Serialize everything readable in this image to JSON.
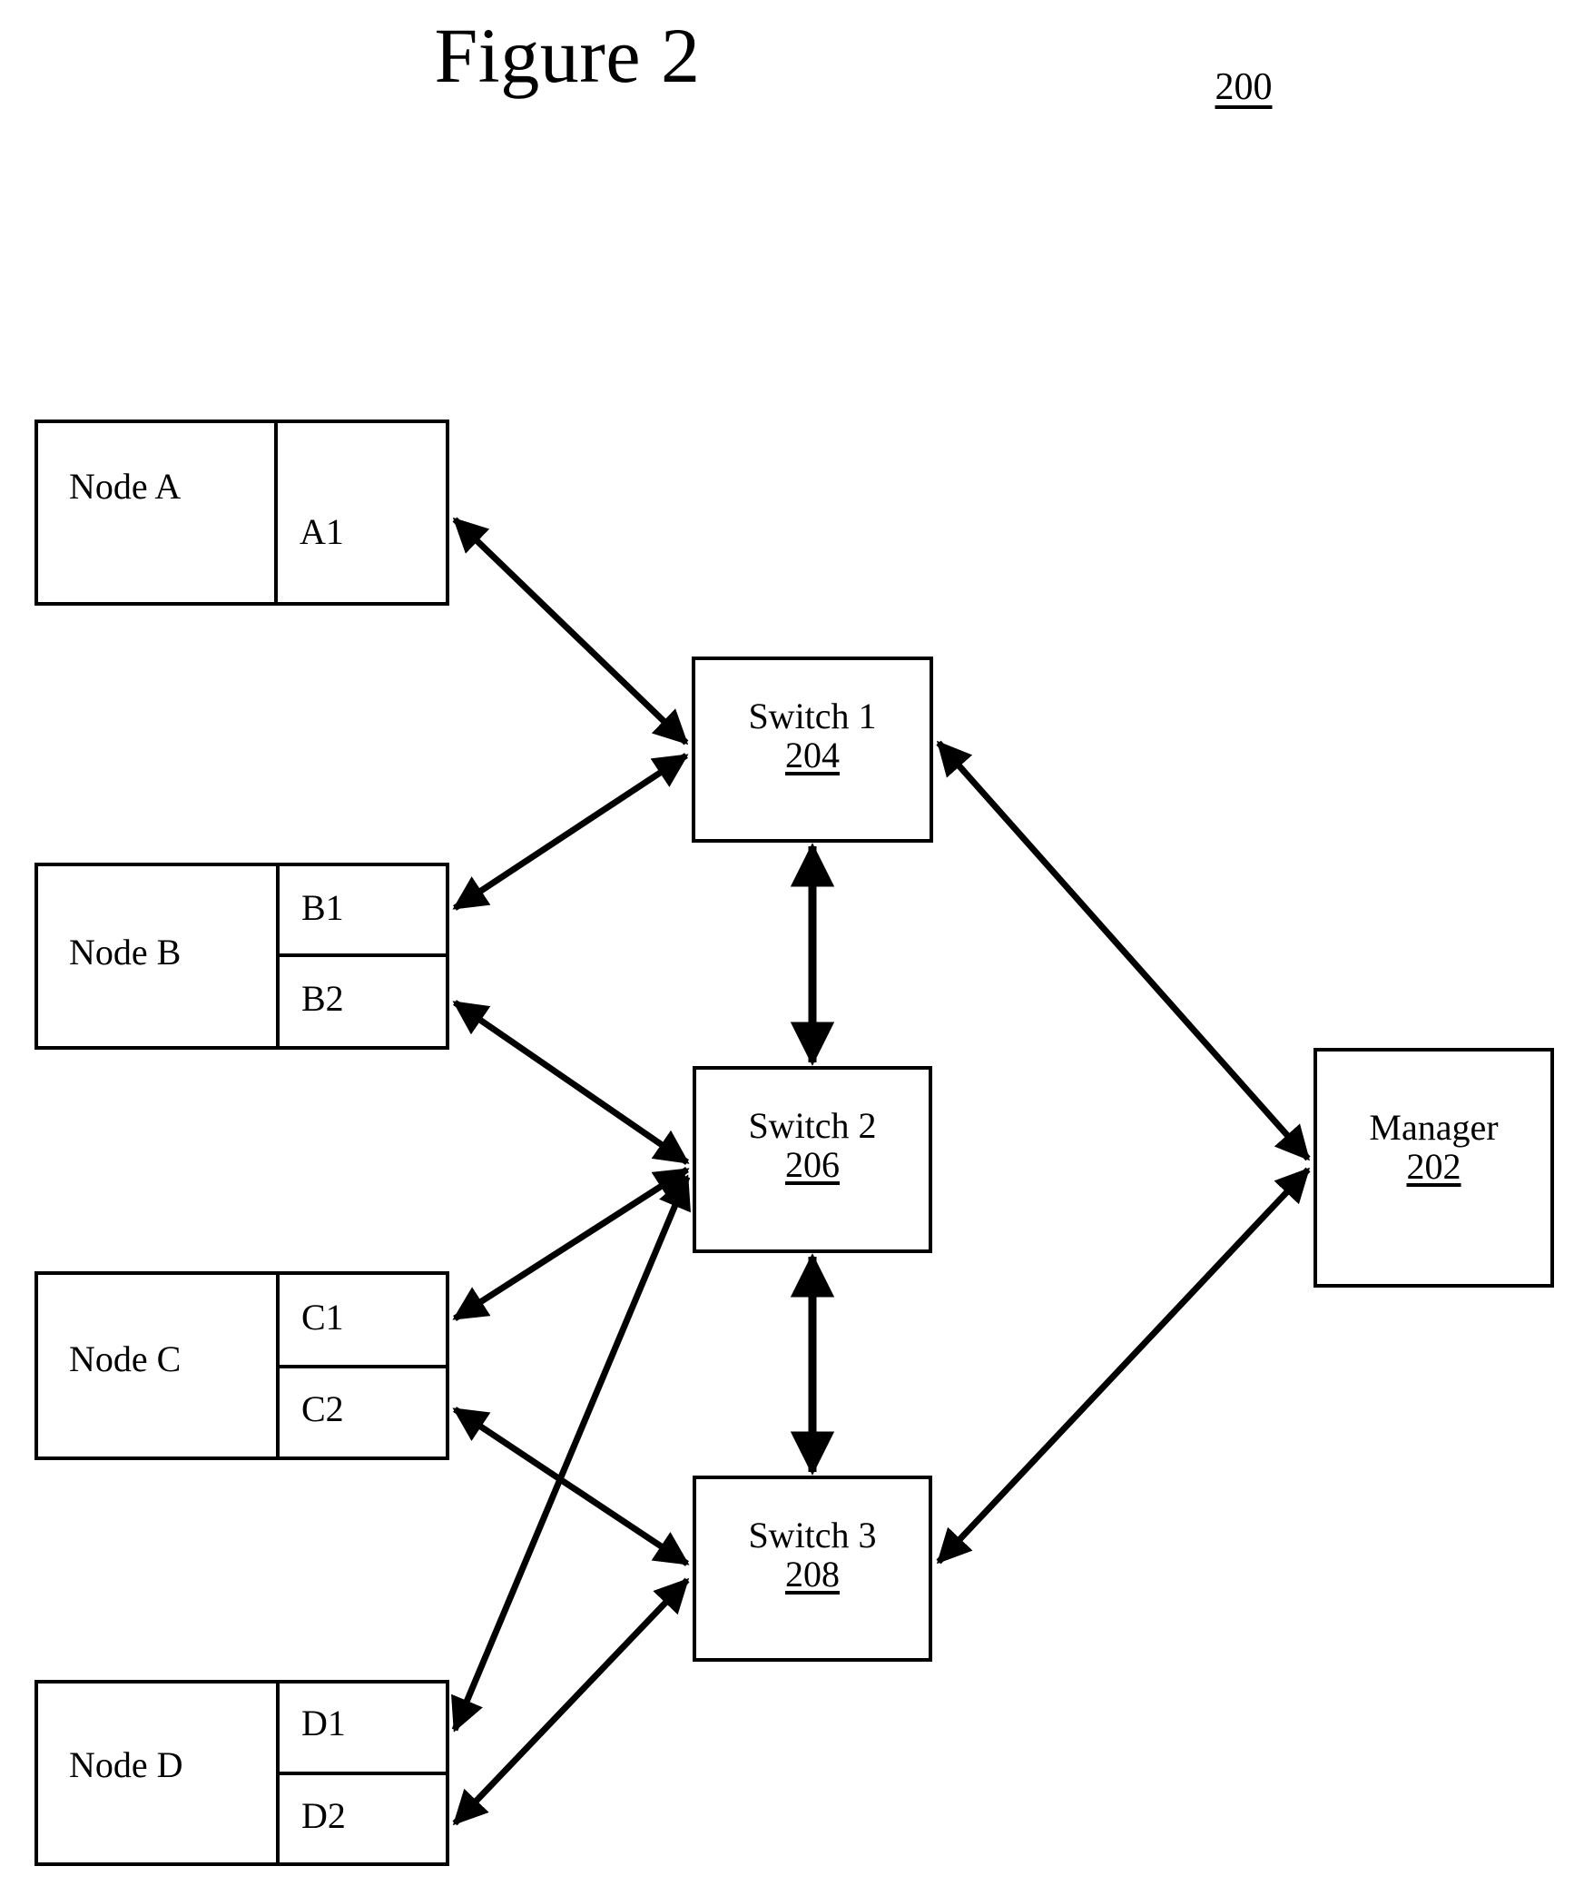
{
  "figure": {
    "title": "Figure 2",
    "ref": "200"
  },
  "nodes": [
    {
      "name": "Node A",
      "ports": [
        "A1"
      ]
    },
    {
      "name": "Node B",
      "ports": [
        "B1",
        "B2"
      ]
    },
    {
      "name": "Node C",
      "ports": [
        "C1",
        "C2"
      ]
    },
    {
      "name": "Node D",
      "ports": [
        "D1",
        "D2"
      ]
    }
  ],
  "switches": [
    {
      "title": "Switch 1",
      "ref": "204"
    },
    {
      "title": "Switch 2",
      "ref": "206"
    },
    {
      "title": "Switch 3",
      "ref": "208"
    }
  ],
  "manager": {
    "title": "Manager",
    "ref": "202"
  },
  "colors": {
    "ink": "#000000",
    "paper": "#ffffff"
  },
  "connections": [
    {
      "from": "A1",
      "to": "Switch 1",
      "style": "double-arrow"
    },
    {
      "from": "B1",
      "to": "Switch 1",
      "style": "double-arrow"
    },
    {
      "from": "Switch 1",
      "to": "Switch 2",
      "style": "double-arrow"
    },
    {
      "from": "Switch 1",
      "to": "Manager",
      "style": "double-arrow"
    },
    {
      "from": "B2",
      "to": "Switch 2",
      "style": "double-arrow"
    },
    {
      "from": "C1",
      "to": "Switch 2",
      "style": "double-arrow"
    },
    {
      "from": "D1",
      "to": "Switch 2",
      "style": "double-arrow"
    },
    {
      "from": "Switch 2",
      "to": "Switch 3",
      "style": "double-arrow"
    },
    {
      "from": "C2",
      "to": "Switch 3",
      "style": "double-arrow"
    },
    {
      "from": "D2",
      "to": "Switch 3",
      "style": "double-arrow"
    },
    {
      "from": "Switch 3",
      "to": "Manager",
      "style": "double-arrow"
    }
  ]
}
